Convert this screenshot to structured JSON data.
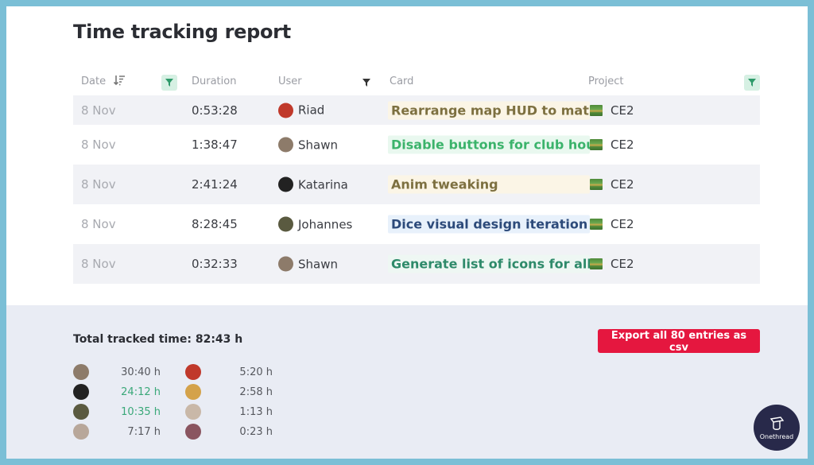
{
  "page": {
    "title": "Time tracking report"
  },
  "table": {
    "headers": {
      "date": "Date",
      "duration": "Duration",
      "user": "User",
      "card": "Card",
      "project": "Project"
    },
    "rows": [
      {
        "date": "8 Nov",
        "duration": "0:53:28",
        "user": "Riad",
        "avatar_color": "#c0392b",
        "card": "Rearrange map HUD to mat",
        "card_color": "#7d7040",
        "card_bg": "#fbf5e6",
        "project": "CE2"
      },
      {
        "date": "8 Nov",
        "duration": "1:38:47",
        "user": "Shawn",
        "avatar_color": "#8d7b6a",
        "card": "Disable buttons for club hou",
        "card_color": "#3bb36b",
        "card_bg": "#e9f8ef",
        "project": "CE2"
      },
      {
        "date": "8 Nov",
        "duration": "2:41:24",
        "user": "Katarina",
        "avatar_color": "#222222",
        "card": "Anim tweaking",
        "card_color": "#7d7040",
        "card_bg": "#fbf5e6",
        "project": "CE2"
      },
      {
        "date": "8 Nov",
        "duration": "8:28:45",
        "user": "Johannes",
        "avatar_color": "#5a5a40",
        "card": "Dice visual design iteration",
        "card_color": "#2c4a7a",
        "card_bg": "#e8f1fb",
        "project": "CE2"
      },
      {
        "date": "8 Nov",
        "duration": "0:32:33",
        "user": "Shawn",
        "avatar_color": "#8d7b6a",
        "card": "Generate list of icons for all",
        "card_color": "#2e8a6a",
        "card_bg": "#eef7f3",
        "project": "CE2"
      }
    ]
  },
  "footer": {
    "total_label": "Total tracked time: 82:43 h",
    "export_label": "Export all 80 entries as csv",
    "users": [
      {
        "hours": "30:40 h",
        "highlight": false,
        "avatar_color": "#8d7b6a"
      },
      {
        "hours": "24:12 h",
        "highlight": true,
        "avatar_color": "#222222"
      },
      {
        "hours": "10:35 h",
        "highlight": true,
        "avatar_color": "#5a5a40"
      },
      {
        "hours": "7:17 h",
        "highlight": false,
        "avatar_color": "#b8a79a"
      },
      {
        "hours": "5:20 h",
        "highlight": false,
        "avatar_color": "#c0392b"
      },
      {
        "hours": "2:58 h",
        "highlight": false,
        "avatar_color": "#d4a24a"
      },
      {
        "hours": "1:13 h",
        "highlight": false,
        "avatar_color": "#c9b8a8"
      },
      {
        "hours": "0:23 h",
        "highlight": false,
        "avatar_color": "#8a5560"
      }
    ]
  },
  "branding": {
    "logo_text": "Onethread"
  },
  "colors": {
    "accent": "#e5173f",
    "filter_active": "#d6f0e3",
    "filter_icon": "#2e9a6a"
  }
}
